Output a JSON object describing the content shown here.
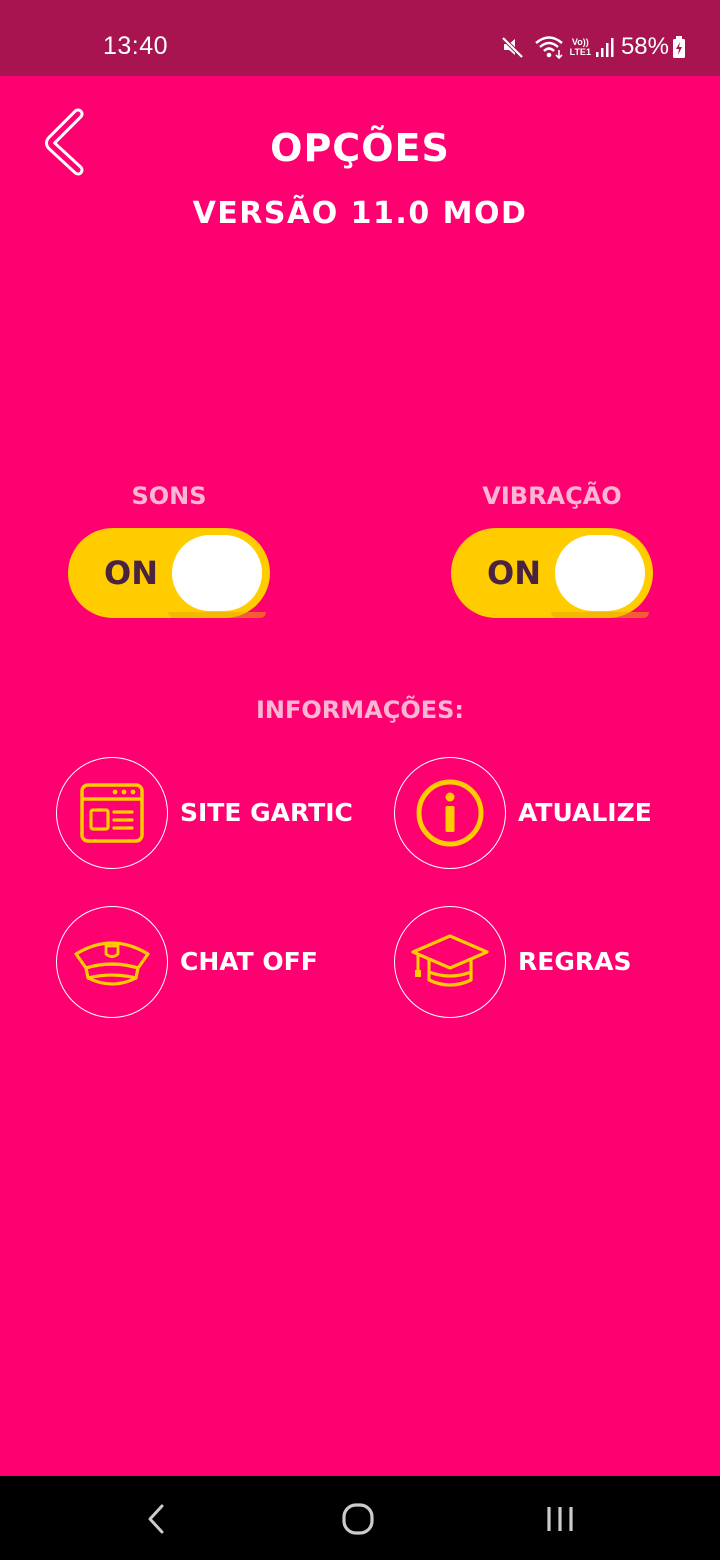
{
  "status_bar": {
    "time": "13:40",
    "network_label": "Vo))\nLTE1",
    "battery": "58%",
    "icons": [
      "mute-icon",
      "wifi-icon",
      "volte-icon",
      "signal-icon",
      "battery-icon"
    ]
  },
  "header": {
    "title": "OPÇÕES",
    "subtitle": "VERSÃO 11.0 MOD",
    "back_icon": "chevron-left-icon"
  },
  "settings": {
    "sounds": {
      "label": "SONS",
      "state": "ON",
      "enabled": true
    },
    "vibration": {
      "label": "VIBRAÇÃO",
      "state": "ON",
      "enabled": true
    }
  },
  "info": {
    "title": "INFORMAÇÕES:",
    "items": [
      {
        "label": "SITE GARTIC",
        "icon": "website-icon"
      },
      {
        "label": "ATUALIZE",
        "icon": "info-icon"
      },
      {
        "label": "CHAT OFF",
        "icon": "police-cap-icon"
      },
      {
        "label": "REGRAS",
        "icon": "graduation-cap-icon"
      }
    ]
  },
  "nav_bar": {
    "icons": [
      "back-icon",
      "home-icon",
      "recents-icon"
    ]
  },
  "colors": {
    "background": "#FF0070",
    "status_bar": "#A8144F",
    "toggle_on": "#FFCC00",
    "accent_icon": "#FFCC00",
    "muted_label": "#F9B7D4",
    "toggle_text": "#4A2340"
  }
}
